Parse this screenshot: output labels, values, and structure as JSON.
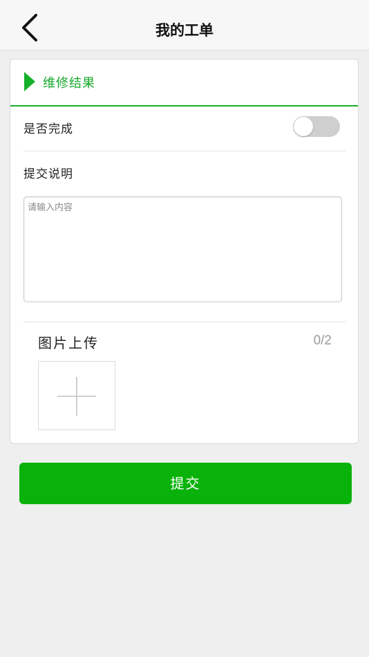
{
  "header": {
    "title": "我的工单",
    "back_icon": "chevron-left-icon"
  },
  "section": {
    "title": "维修结果",
    "accent_color": "#16b12b"
  },
  "form": {
    "completed_label": "是否完成",
    "completed_value": false,
    "description_label": "提交说明",
    "description_placeholder": "请输入内容",
    "description_value": ""
  },
  "upload": {
    "title": "图片上传",
    "count": "0/2",
    "add_icon": "plus-icon"
  },
  "submit": {
    "label": "提交",
    "color": "#08b20a"
  }
}
